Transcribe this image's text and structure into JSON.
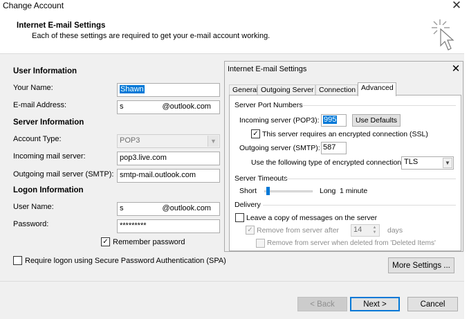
{
  "window": {
    "title": "Change Account",
    "header_title": "Internet E-mail Settings",
    "header_subtitle": "Each of these settings are required to get your e-mail account working."
  },
  "user_info": {
    "section": "User Information",
    "name_label": "Your Name:",
    "name_value": "Shawn",
    "email_label": "E-mail Address:",
    "email_prefix": "s",
    "email_suffix": "@outlook.com"
  },
  "server_info": {
    "section": "Server Information",
    "account_type_label": "Account Type:",
    "account_type_value": "POP3",
    "incoming_label": "Incoming mail server:",
    "incoming_value": "pop3.live.com",
    "outgoing_label": "Outgoing mail server (SMTP):",
    "outgoing_value": "smtp-mail.outlook.com"
  },
  "logon_info": {
    "section": "Logon Information",
    "username_label": "User Name:",
    "username_prefix": "s",
    "username_suffix": "@outlook.com",
    "password_label": "Password:",
    "password_value": "*********",
    "remember_label": "Remember password",
    "remember_checked": true,
    "spa_label": "Require logon using Secure Password Authentication (SPA)",
    "spa_checked": false
  },
  "more_settings_label": "More Settings ...",
  "footer": {
    "back_label": "< Back",
    "next_label": "Next >",
    "cancel_label": "Cancel"
  },
  "inner_dialog": {
    "title": "Internet E-mail Settings",
    "tabs": [
      "General",
      "Outgoing Server",
      "Connection",
      "Advanced"
    ],
    "active_tab": "Advanced",
    "ports_group": "Server Port Numbers",
    "incoming_port_label": "Incoming server (POP3):",
    "incoming_port_value": "995",
    "use_defaults_label": "Use Defaults",
    "ssl_label": "This server requires an encrypted connection (SSL)",
    "ssl_checked": true,
    "outgoing_port_label": "Outgoing server (SMTP):",
    "outgoing_port_value": "587",
    "encryption_label": "Use the following type of encrypted connection:",
    "encryption_value": "TLS",
    "timeouts_group": "Server Timeouts",
    "timeout_short": "Short",
    "timeout_long": "Long",
    "timeout_value": "1 minute",
    "timeout_level": 0.05,
    "delivery_group": "Delivery",
    "leave_copy_label": "Leave a copy of messages on the server",
    "remove_after_label": "Remove from server after",
    "remove_after_days": "14",
    "days_label": "days",
    "remove_deleted_label": "Remove from server when deleted from 'Deleted Items'"
  },
  "colors": {
    "accent": "#0078d7",
    "background": "#f0f0f0"
  }
}
